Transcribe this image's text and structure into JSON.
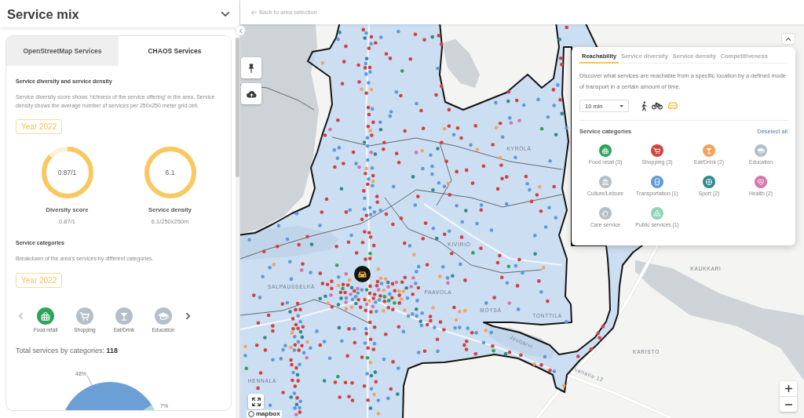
{
  "side_panel": {
    "title": "Service mix",
    "tabs": [
      {
        "label": "OpenStreetMap Services",
        "selected": false
      },
      {
        "label": "CHAOS Services",
        "selected": true
      }
    ],
    "diversity": {
      "heading": "Service diversity and service density",
      "description": "Service diversity score shows 'richness of the service offering' in the area. Service density shows the average number of services per 250x250 meter grid cell.",
      "year": "Year 2022",
      "gauges": [
        {
          "value": "0.87/1",
          "level": 0.87,
          "label": "Diversity score",
          "reading": "0.87/1"
        },
        {
          "value": "6.1",
          "level": 1,
          "label": "Service density",
          "reading": "6.1/250x250m"
        }
      ]
    },
    "categories": {
      "heading": "Service categories",
      "description": "Breakdown of the area's services by different categories.",
      "year": "Year 2022",
      "carousel": {
        "previous": {
          "disabled": true
        },
        "next": {
          "disabled": false
        },
        "items": [
          {
            "kind": "food_retail",
            "label": "Food retail",
            "selected": true,
            "color": "#2ba55d"
          },
          {
            "kind": "shopping",
            "label": "Shopping",
            "selected": false
          },
          {
            "kind": "eat_drink",
            "label": "Eat/Drink",
            "selected": false
          },
          {
            "kind": "education",
            "label": "Education",
            "selected": false
          }
        ]
      },
      "total": "Total services by categories: **118**",
      "chart_data": {
        "type": "pie",
        "values": [
          48,
          7
        ],
        "value_labels": [
          "48%",
          "7%"
        ]
      }
    }
  },
  "top_bar": {
    "back_link": "Back to area selection"
  },
  "map": {
    "place_labels": [
      "KYRÖLÄ",
      "KIVIRIÖ",
      "SALPAUSSELKÄ",
      "PAAVOLA",
      "MÖYSÄ",
      "TONTTILA",
      "KAUKKARI",
      "Joutjärvi",
      "KARISTO",
      "Valtatie 12",
      "HENNALA"
    ],
    "attribution": "mapbox"
  },
  "analysis_panel": {
    "tabs": [
      {
        "label": "Reachability",
        "selected": true
      },
      {
        "label": "Service diversity",
        "selected": false
      },
      {
        "label": "Service density",
        "selected": false
      },
      {
        "label": "Competitiveness",
        "selected": false
      }
    ],
    "description": "Discover what services are reachable from a specific location by a defined mode of transport in a certain amount of time.",
    "time_select": {
      "value": "10 min"
    },
    "transport_modes": [
      {
        "kind": "walk",
        "selected": false
      },
      {
        "kind": "bike",
        "selected": false
      },
      {
        "kind": "car",
        "selected": true
      }
    ],
    "categories_heading": "Service categories",
    "deselect_all": "Deselect all",
    "categories": [
      {
        "kind": "food_retail",
        "label": "Food retail (3)",
        "color": "#2ba55d"
      },
      {
        "kind": "shopping",
        "label": "Shopping (3)",
        "color": "#d0443f"
      },
      {
        "kind": "eat_drink",
        "label": "Eat/Drink (2)",
        "color": "#f2a35e"
      },
      {
        "kind": "education",
        "label": "Education",
        "color": "#b4bec9"
      },
      {
        "kind": "culture",
        "label": "Culture/Leisure",
        "color": "#b4bec9"
      },
      {
        "kind": "transport",
        "label": "Transportation (1)",
        "color": "#5f9ad6"
      },
      {
        "kind": "sport",
        "label": "Sport (2)",
        "color": "#2f8a8e"
      },
      {
        "kind": "health",
        "label": "Health (2)",
        "color": "#d677ad"
      },
      {
        "kind": "care",
        "label": "Care service",
        "color": "#b4bec9"
      },
      {
        "kind": "public",
        "label": "Public services (1)",
        "color": "#8fd4b4"
      }
    ]
  }
}
